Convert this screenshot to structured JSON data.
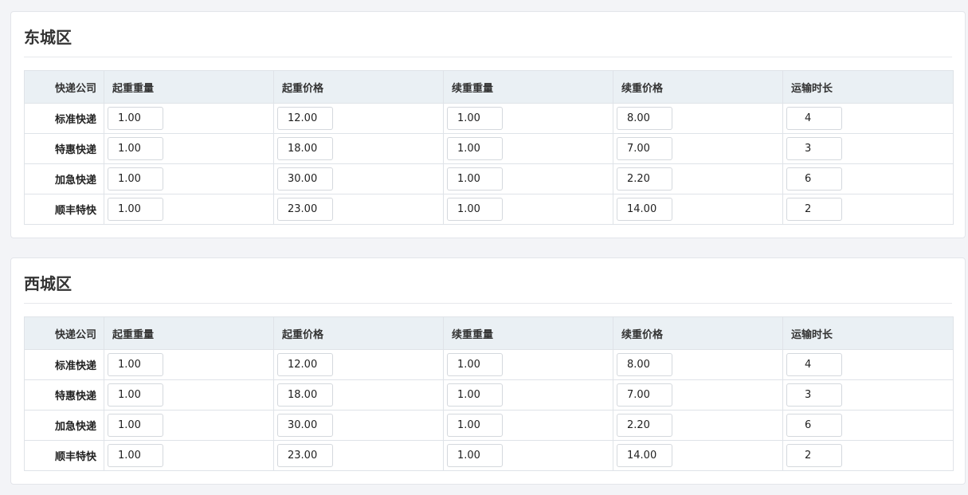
{
  "columns": {
    "company": "快递公司",
    "first_weight": "起重重量",
    "first_price": "起重价格",
    "extra_weight": "续重重量",
    "extra_price": "续重价格",
    "transit_time": "运输时长"
  },
  "regions": [
    {
      "title": "东城区",
      "rows": [
        {
          "company": "标准快递",
          "first_weight": "1.00",
          "first_price": "12.00",
          "extra_weight": "1.00",
          "extra_price": "8.00",
          "transit_time": "4"
        },
        {
          "company": "特惠快递",
          "first_weight": "1.00",
          "first_price": "18.00",
          "extra_weight": "1.00",
          "extra_price": "7.00",
          "transit_time": "3"
        },
        {
          "company": "加急快递",
          "first_weight": "1.00",
          "first_price": "30.00",
          "extra_weight": "1.00",
          "extra_price": "2.20",
          "transit_time": "6"
        },
        {
          "company": "顺丰特快",
          "first_weight": "1.00",
          "first_price": "23.00",
          "extra_weight": "1.00",
          "extra_price": "14.00",
          "transit_time": "2"
        }
      ]
    },
    {
      "title": "西城区",
      "rows": [
        {
          "company": "标准快递",
          "first_weight": "1.00",
          "first_price": "12.00",
          "extra_weight": "1.00",
          "extra_price": "8.00",
          "transit_time": "4"
        },
        {
          "company": "特惠快递",
          "first_weight": "1.00",
          "first_price": "18.00",
          "extra_weight": "1.00",
          "extra_price": "7.00",
          "transit_time": "3"
        },
        {
          "company": "加急快递",
          "first_weight": "1.00",
          "first_price": "30.00",
          "extra_weight": "1.00",
          "extra_price": "2.20",
          "transit_time": "6"
        },
        {
          "company": "顺丰特快",
          "first_weight": "1.00",
          "first_price": "23.00",
          "extra_weight": "1.00",
          "extra_price": "14.00",
          "transit_time": "2"
        }
      ]
    }
  ]
}
